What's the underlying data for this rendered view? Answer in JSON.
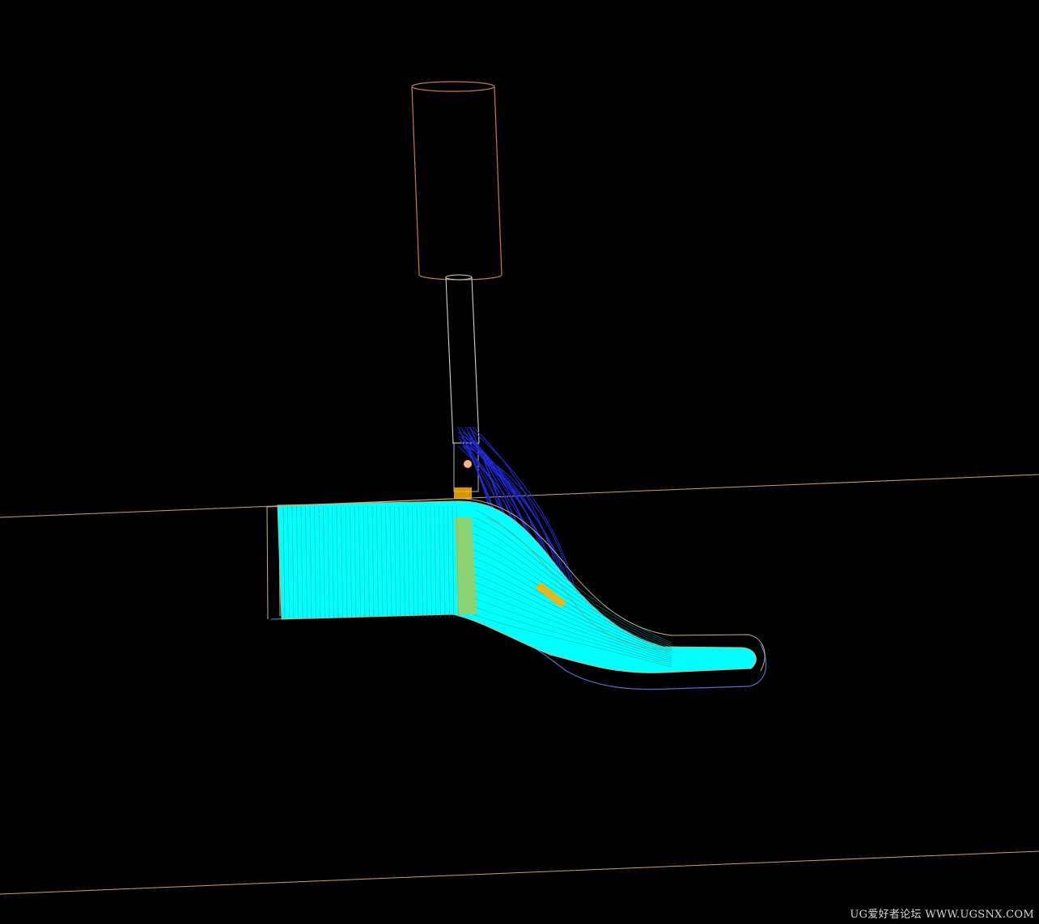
{
  "viewport": {
    "background": "#000000",
    "colors": {
      "holder": "#c47a52",
      "tool_shank": "#cfcfcf",
      "workpiece_fill": "#00ffff",
      "workpiece_edge": "#c8b27a",
      "part_outline_blue": "#4a6fe0",
      "toolpath_blue": "#1f2bd6",
      "highlight_orange": "#ffb000",
      "reference_line": "#c8a07a",
      "tool_tip": "#ffb080"
    },
    "icons": {
      "tool_holder": "cylinder-holder-icon",
      "cutter": "ball-end-mill-icon",
      "part": "machined-part-icon"
    }
  },
  "watermark": {
    "text": "UG爱好者论坛 WWW.UGSNX.COM",
    "color": "#d8d8d8"
  }
}
